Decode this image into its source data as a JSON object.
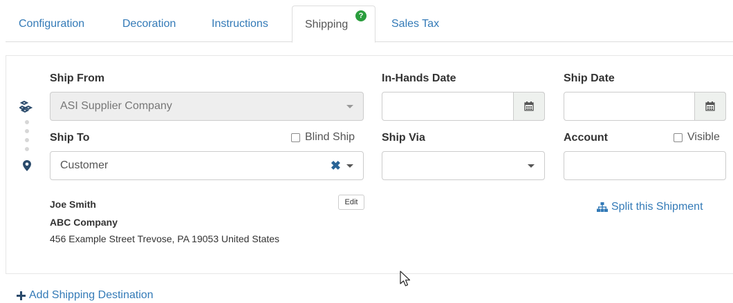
{
  "tabs": [
    {
      "label": "Configuration"
    },
    {
      "label": "Decoration"
    },
    {
      "label": "Instructions"
    },
    {
      "label": "Shipping",
      "badge": "?"
    },
    {
      "label": "Sales Tax"
    }
  ],
  "ship_from": {
    "label": "Ship From",
    "value": "ASI Supplier Company"
  },
  "in_hands": {
    "label": "In-Hands Date",
    "value": ""
  },
  "ship_date": {
    "label": "Ship Date",
    "value": ""
  },
  "ship_to": {
    "label": "Ship To",
    "value": "Customer",
    "blind_ship_label": "Blind Ship",
    "clear": "✖"
  },
  "ship_via": {
    "label": "Ship Via",
    "value": ""
  },
  "account": {
    "label": "Account",
    "visible_label": "Visible",
    "value": ""
  },
  "address": {
    "name": "Joe Smith",
    "company": "ABC Company",
    "line": "456 Example Street Trevose, PA 19053 United States",
    "edit_label": "Edit"
  },
  "split_label": "Split this Shipment",
  "add_destination_label": "Add Shipping Destination",
  "colors": {
    "link": "#337ab7",
    "badge": "#2a9d3d",
    "icon": "#2a4a6b"
  }
}
